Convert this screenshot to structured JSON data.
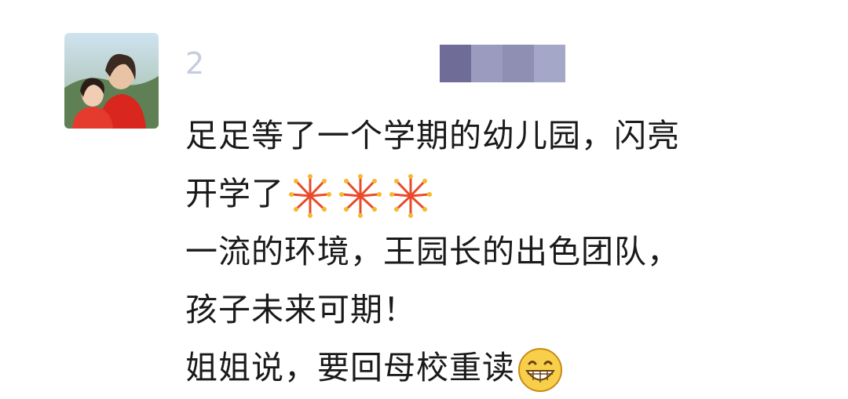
{
  "post": {
    "author_visible_char": "2",
    "lines": [
      "足足等了一个学期的幼儿园，闪亮",
      "开学了",
      "一流的环境，王园长的出色团队，",
      "孩子未来可期！",
      "姐姐说，要回母校重读"
    ],
    "line2_emoji": "fireworks-icon",
    "line5_emoji": "grinning-face-icon"
  },
  "colors": {
    "text": "#1a1a1a",
    "mosaic": [
      "#6f6c98",
      "#9a9bbf",
      "#8f8fb4",
      "#a5a7c8"
    ]
  }
}
